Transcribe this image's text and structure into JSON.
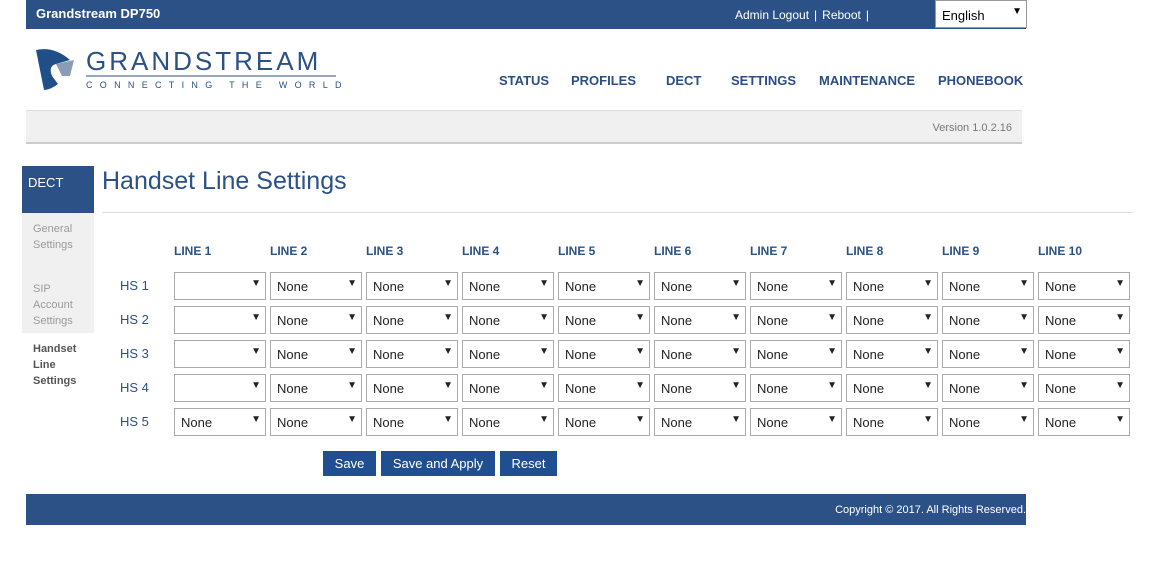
{
  "header": {
    "title": "Grandstream DP750",
    "admin_logout": "Admin Logout",
    "reboot": "Reboot",
    "language": "English"
  },
  "logo": {
    "brand": "GRANDSTREAM",
    "tagline": "CONNECTING THE WORLD"
  },
  "nav": [
    "STATUS",
    "PROFILES",
    "DECT",
    "SETTINGS",
    "MAINTENANCE",
    "PHONEBOOK"
  ],
  "version": "Version 1.0.2.16",
  "sidebar": {
    "header": "DECT",
    "items": [
      [
        "General",
        "Settings"
      ],
      [
        "SIP",
        "Account",
        "Settings"
      ],
      [
        "Handset",
        "Line",
        "Settings"
      ]
    ],
    "active": 2
  },
  "page": {
    "title": "Handset Line Settings"
  },
  "table": {
    "columns": [
      "LINE 1",
      "LINE 2",
      "LINE 3",
      "LINE 4",
      "LINE 5",
      "LINE 6",
      "LINE 7",
      "LINE 8",
      "LINE 9",
      "LINE 10"
    ],
    "rows": [
      {
        "label": "HS 1",
        "values": [
          "",
          "None",
          "None",
          "None",
          "None",
          "None",
          "None",
          "None",
          "None",
          "None"
        ]
      },
      {
        "label": "HS 2",
        "values": [
          "",
          "None",
          "None",
          "None",
          "None",
          "None",
          "None",
          "None",
          "None",
          "None"
        ]
      },
      {
        "label": "HS 3",
        "values": [
          "",
          "None",
          "None",
          "None",
          "None",
          "None",
          "None",
          "None",
          "None",
          "None"
        ]
      },
      {
        "label": "HS 4",
        "values": [
          "",
          "None",
          "None",
          "None",
          "None",
          "None",
          "None",
          "None",
          "None",
          "None"
        ]
      },
      {
        "label": "HS 5",
        "values": [
          "None",
          "None",
          "None",
          "None",
          "None",
          "None",
          "None",
          "None",
          "None",
          "None"
        ]
      }
    ]
  },
  "buttons": {
    "save": "Save",
    "save_apply": "Save and Apply",
    "reset": "Reset"
  },
  "footer": {
    "copyright": "Copyright © 2017. All Rights Reserved."
  }
}
